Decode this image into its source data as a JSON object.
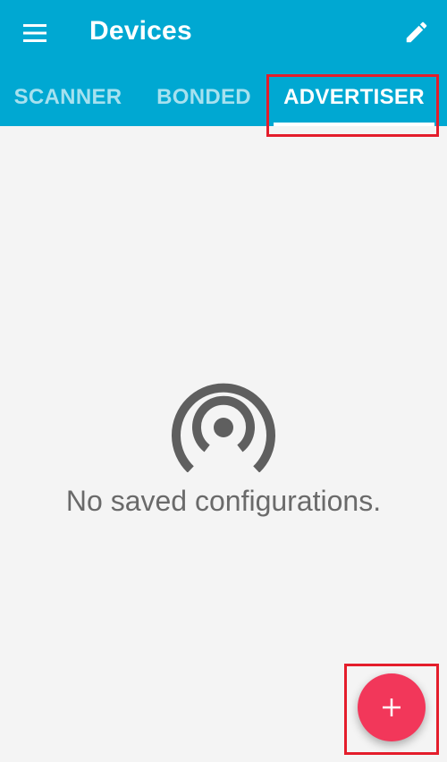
{
  "app": {
    "title": "Devices"
  },
  "toolbar": {
    "menu_icon": "menu-icon",
    "edit_icon": "edit-icon"
  },
  "tabs": [
    {
      "label": "SCANNER",
      "active": false
    },
    {
      "label": "BONDED",
      "active": false
    },
    {
      "label": "ADVERTISER",
      "active": true
    }
  ],
  "empty_state": {
    "icon": "broadcast-icon",
    "message": "No saved configurations."
  },
  "fab": {
    "label": "+",
    "icon": "add-icon"
  },
  "colors": {
    "appbar": "#00a8d2",
    "background": "#f4f4f4",
    "fab": "#f2375a",
    "highlight": "#e41d2b",
    "empty_icon": "#5f5f5f"
  }
}
